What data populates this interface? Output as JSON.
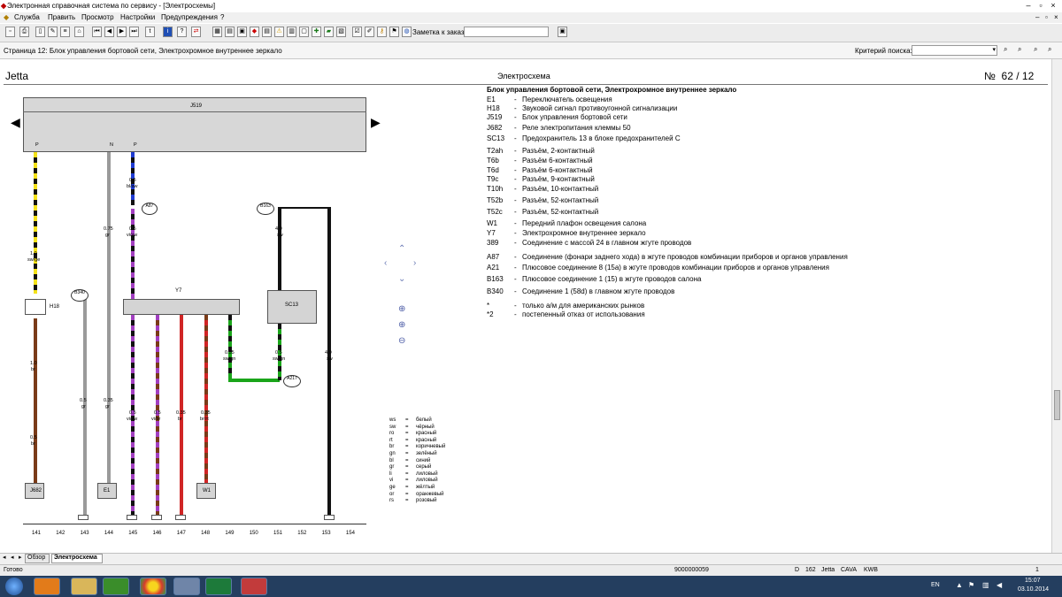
{
  "window": {
    "title": "Электронная справочная система по сервису - [Электросхемы]"
  },
  "menu": [
    "Служба",
    "Править",
    "Просмотр",
    "Настройки",
    "Предупреждения",
    "?"
  ],
  "toolbar": {
    "order_label": "Заметка к заказу:",
    "order_value": ""
  },
  "page": {
    "breadcrumb": "Страница 12: Блок управления бортовой сети, Электрохромное внутреннее зеркало",
    "search_label": "Критерий поиска:",
    "search_value": ""
  },
  "header": {
    "model": "Jetta",
    "section": "Электросхема",
    "number": "№  62 / 12"
  },
  "legend": {
    "title": "Блок управления бортовой сети, Электрохромное внутреннее зеркало",
    "items": [
      {
        "code": "E1",
        "desc": "Переключатель освещения"
      },
      {
        "code": "H18",
        "desc": "Звуковой сигнал противоугонной сигнализации"
      },
      {
        "code": "J519",
        "desc": "Блок управления бортовой сети"
      },
      {
        "code": "J682",
        "desc": "Реле электропитания клеммы 50"
      },
      {
        "code": "SC13",
        "desc": "Предохранитель 13 в блоке предохранителей C"
      },
      {
        "code": "T2ah",
        "desc": "Разъём, 2-контактный"
      },
      {
        "code": "T6b",
        "desc": "Разъём 6-контактный"
      },
      {
        "code": "T6d",
        "desc": "Разъём 6-контактный"
      },
      {
        "code": "T9c",
        "desc": "Разъём, 9-контактный"
      },
      {
        "code": "T10h",
        "desc": "Разъём, 10-контактный"
      },
      {
        "code": "T52b",
        "desc": "Разъём, 52-контактный"
      },
      {
        "code": "T52c",
        "desc": "Разъём, 52-контактный"
      },
      {
        "code": "W1",
        "desc": "Передний плафон освещения салона"
      },
      {
        "code": "Y7",
        "desc": "Электрохромное внутреннее зеркало"
      },
      {
        "code": "389",
        "desc": "Соединение с массой 24 в главном жгуте проводов"
      },
      {
        "code": "A87",
        "desc": "Соединение (фонари заднего хода) в жгуте проводов комбинации приборов и органов управления"
      },
      {
        "code": "A21",
        "desc": "Плюсовое соединение 8 (15а) в жгуте проводов комбинации приборов и органов управления"
      },
      {
        "code": "B163",
        "desc": "Плюсовое соединение 1 (15) в жгуте проводов салона"
      },
      {
        "code": "B340",
        "desc": "Соединение 1 (58d) в главном жгуте проводов"
      },
      {
        "code": "*",
        "desc": "только а/м для американских рынков"
      },
      {
        "code": "*2",
        "desc": "постепенный отказ от использования"
      }
    ]
  },
  "diagram": {
    "unit_top": "J519",
    "unit_y7": "Y7",
    "unit_sc": "SC13",
    "h18": "H18",
    "j682": "J682",
    "e1": "E1",
    "w1": "W1",
    "pin_p1": "P",
    "pin_n": "N",
    "pin_p2": "P",
    "w1_size": "1.0",
    "w1_col": "sw/ge",
    "w2_size": "0.75",
    "w2_col": "gr",
    "w3_size": "0.5",
    "w3_col": "bl/sw",
    "w4_size": "0.5",
    "w4_col": "vi/sw",
    "w5_size": "4.0",
    "w5_col": "sw",
    "w6_size": "1.0",
    "w6_col": "br",
    "w7_size": "0.5",
    "w7_col": "br",
    "w8_size": "0.5",
    "w8_col": "gr",
    "w9_size": "0.35",
    "w9_col": "gr",
    "w10_size": "0.5",
    "w10_col": "vi/sw",
    "w11_size": "0.5",
    "w11_col": "vi/br",
    "w12_size": "0.35",
    "w12_col": "br",
    "w13_size": "0.35",
    "w13_col": "br/rt",
    "w14_size": "0.35",
    "w14_col": "sw/gn",
    "w15_size": "0.5",
    "w15_col": "sw/gn",
    "w16_size": "4.0",
    "w16_col": "sw",
    "c_a87": "A87",
    "c_b163": "B163",
    "c_b340": "B340",
    "c_a217": "A217",
    "axis": [
      "141",
      "142",
      "143",
      "144",
      "145",
      "146",
      "147",
      "148",
      "149",
      "150",
      "151",
      "152",
      "153",
      "154"
    ],
    "colors_key": [
      [
        "ws",
        "белый"
      ],
      [
        "sw",
        "чёрный"
      ],
      [
        "ro",
        "красный"
      ],
      [
        "rt",
        "красный"
      ],
      [
        "br",
        "коричневый"
      ],
      [
        "gn",
        "зелёный"
      ],
      [
        "bl",
        "синий"
      ],
      [
        "gr",
        "серый"
      ],
      [
        "li",
        "лиловый"
      ],
      [
        "vi",
        "лиловый"
      ],
      [
        "ge",
        "жёлтый"
      ],
      [
        "or",
        "оранжевый"
      ],
      [
        "rs",
        "розовый"
      ]
    ]
  },
  "tabs": {
    "overview": "Обзор",
    "schematic": "Электросхема"
  },
  "status": {
    "ready": "Готово",
    "id": "9000000059",
    "d": "D",
    "num": "162",
    "model": "Jetta",
    "code": "CAVA",
    "kwb": "KWB",
    "page": "1"
  },
  "taskbar": {
    "lang": "EN",
    "time": "15:07",
    "date": "03.10.2014"
  },
  "colors": {
    "wire_yellow": "#f4e21a",
    "wire_violet": "#a23fc0",
    "wire_red": "#d02525",
    "wire_green": "#1aa51a",
    "wire_grey": "#9a9a9a",
    "wire_blue": "#1f3bd1"
  }
}
